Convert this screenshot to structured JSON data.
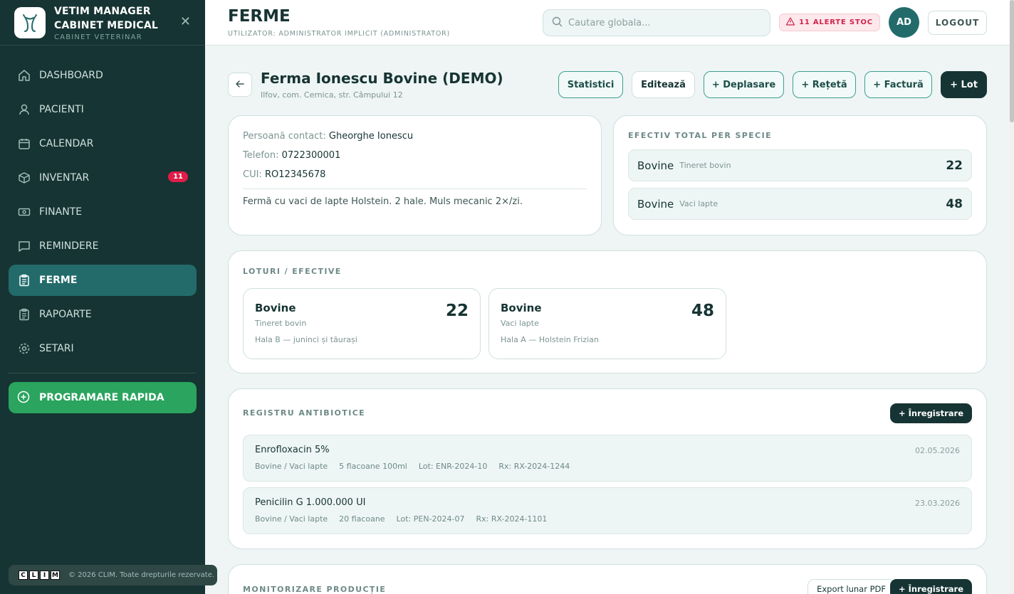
{
  "brand": {
    "name_line1": "VETIM MANAGER",
    "name_line2": "CABINET MEDICAL",
    "subtitle": "CABINET VETERINAR"
  },
  "sidebar": {
    "items": [
      {
        "label": "DASHBOARD",
        "icon": "home-icon"
      },
      {
        "label": "PACIENTI",
        "icon": "user-icon"
      },
      {
        "label": "CALENDAR",
        "icon": "calendar-icon"
      },
      {
        "label": "INVENTAR",
        "icon": "box-icon",
        "badge": "11"
      },
      {
        "label": "FINANTE",
        "icon": "money-icon"
      },
      {
        "label": "REMINDERE",
        "icon": "message-icon"
      },
      {
        "label": "FERME",
        "icon": "clipboard-icon",
        "active": true
      },
      {
        "label": "RAPOARTE",
        "icon": "report-icon"
      },
      {
        "label": "SETARI",
        "icon": "gear-icon"
      }
    ],
    "quick_action": "PROGRAMARE RAPIDA",
    "footer": {
      "logo_letters": [
        "C",
        "L",
        "I",
        "M"
      ],
      "text": "© 2026 CLIM. Toate drepturile rezervate."
    }
  },
  "header": {
    "title": "FERME",
    "user_line": "UTILIZATOR: ADMINISTRATOR IMPLICIT (ADMINISTRATOR)",
    "search_placeholder": "Cautare globala...",
    "alert": "11 ALERTE STOC",
    "avatar": "AD",
    "logout": "LOGOUT"
  },
  "farm": {
    "name": "Ferma Ionescu Bovine (DEMO)",
    "address": "Ilfov, com. Cernica, str. Câmpului 12",
    "actions": [
      "Statistici",
      "Editează",
      "+ Deplasare",
      "+ Rețetă",
      "+ Factură",
      "+ Lot"
    ],
    "contact_label": "Persoană contact:",
    "contact_value": "Gheorghe Ionescu",
    "phone_label": "Telefon:",
    "phone_value": "0722300001",
    "cui_label": "CUI:",
    "cui_value": "RO12345678",
    "note": "Fermă cu vaci de lapte Holstein. 2 hale. Muls mecanic 2×/zi."
  },
  "species": {
    "title": "EFECTIV TOTAL PER SPECIE",
    "rows": [
      {
        "name": "Bovine",
        "sub": "Tineret bovin",
        "count": "22"
      },
      {
        "name": "Bovine",
        "sub": "Vaci lapte",
        "count": "48"
      }
    ]
  },
  "lots": {
    "title": "LOTURI / EFECTIVE",
    "items": [
      {
        "name": "Bovine",
        "sub": "Tineret bovin",
        "desc": "Hala B — juninci și tăurași",
        "count": "22"
      },
      {
        "name": "Bovine",
        "sub": "Vaci lapte",
        "desc": "Hala A — Holstein Frizian",
        "count": "48"
      }
    ]
  },
  "antibiotics": {
    "title": "REGISTRU ANTIBIOTICE",
    "add_label": "+ Înregistrare",
    "rows": [
      {
        "name": "Enrofloxacin 5%",
        "group": "Bovine / Vaci lapte",
        "qty": "5 flacoane 100ml",
        "lot": "Lot: ENR-2024-10",
        "rx": "Rx: RX-2024-1244",
        "date": "02.05.2026"
      },
      {
        "name": "Penicilin G 1.000.000 UI",
        "group": "Bovine / Vaci lapte",
        "qty": "20 flacoane",
        "lot": "Lot: PEN-2024-07",
        "rx": "Rx: RX-2024-1101",
        "date": "23.03.2026"
      }
    ]
  },
  "production": {
    "title": "MONITORIZARE PRODUCȚIE",
    "export_label": "Export lunar PDF",
    "add_label": "+ Înregistrare"
  },
  "colors": {
    "sidebar": "#163433",
    "active": "#236b6b",
    "accent_green": "#2aa45e",
    "alert": "#e11d48"
  }
}
